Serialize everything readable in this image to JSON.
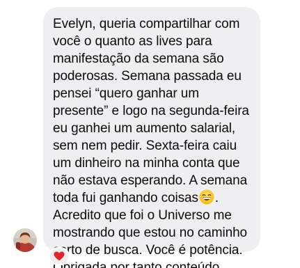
{
  "message": {
    "text_part1": "Evelyn, queria compartilhar com você o quanto as lives para manifestação da semana são poderosas. Semana passada eu pensei “quero ganhar um presente” e logo na segunda-feira eu ganhei um aumento salarial, sem nem pedir. Sexta-feira caiu um dinheiro na minha conta que não estava esperando. A semana toda fui ganhando coisas",
    "inline_emoji": "grinning-face-with-smiling-eyes",
    "text_part2": ". Acredito que foi o Universo me mostrando que estou no caminho certo de busca. Você é potência. Obrigada por tanto conteúdo."
  },
  "reaction": {
    "emoji": "heart",
    "color": "#e0262a"
  },
  "colors": {
    "bubble": "#efeff1",
    "text": "#0b0b0b",
    "background": "#ffffff"
  }
}
